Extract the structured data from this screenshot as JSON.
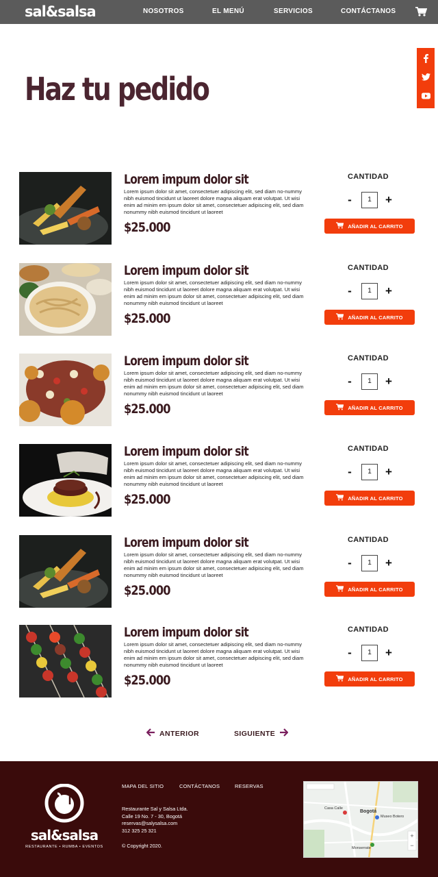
{
  "nav": {
    "logo": "sal&salsa",
    "links": [
      "NOSOTROS",
      "EL MENÚ",
      "SERVICIOS",
      "CONTÁCTANOS"
    ]
  },
  "page": {
    "title": "Haz tu pedido"
  },
  "products": [
    {
      "name": "Lorem impum dolor sit",
      "price": "$25.000",
      "qty_label": "CANTIDAD",
      "qty": "1",
      "button": "AÑADIR AL CARRITO"
    },
    {
      "name": "Lorem impum dolor sit",
      "price": "$25.000",
      "qty_label": "CANTIDAD",
      "qty": "1",
      "button": "AÑADIR AL CARRITO"
    },
    {
      "name": "Lorem impum dolor sit",
      "price": "$25.000",
      "qty_label": "CANTIDAD",
      "qty": "1",
      "button": "AÑADIR AL CARRITO"
    },
    {
      "name": "Lorem impum dolor sit",
      "price": "$25.000",
      "qty_label": "CANTIDAD",
      "qty": "1",
      "button": "AÑADIR AL CARRITO"
    },
    {
      "name": "Lorem impum dolor sit",
      "price": "$25.000",
      "qty_label": "CANTIDAD",
      "qty": "1",
      "button": "AÑADIR AL CARRITO"
    },
    {
      "name": "Lorem impum dolor sit",
      "price": "$25.000",
      "qty_label": "CANTIDAD",
      "qty": "1",
      "button": "AÑADIR AL CARRITO"
    }
  ],
  "description": "Lorem ipsum dolor sit amet, consectetuer adipiscing elit, sed diam no-nummy nibh euismod tincidunt ut laoreet dolore magna aliquam erat volutpat. Ut wisi enim ad minim em ipsum dolor sit amet, consectetuer adipiscing elit, sed diam nonummy nibh euismod tincidunt ut laoreet",
  "pager": {
    "prev": "ANTERIOR",
    "next": "SIGUIENTE"
  },
  "footer": {
    "logo": "sal&salsa",
    "tagline": "RESTAURANTE • RUMBA • EVENTOS",
    "links": [
      "MAPA DEL SITIO",
      "CONTÁCTANOS",
      "RESERVAS"
    ],
    "address": [
      "Restaurante Sal y Salsa Ltda.",
      "Calle 19 No. 7 - 30, Bogotá",
      "reservas@salysalsa.com",
      "312 325 25 321"
    ],
    "copyright": "© Copyright 2020.",
    "map_labels": [
      "Bogotá",
      "Casa Calle",
      "Museo Botero",
      "Monserrate"
    ]
  },
  "colors": {
    "accent": "#f23d0c",
    "title": "#4b2530",
    "footer": "#3a0b0b",
    "nav": "#5b5b5b"
  },
  "icons": [
    "cart-icon",
    "facebook-icon",
    "twitter-icon",
    "youtube-icon",
    "arrow-left-icon",
    "arrow-right-icon"
  ]
}
